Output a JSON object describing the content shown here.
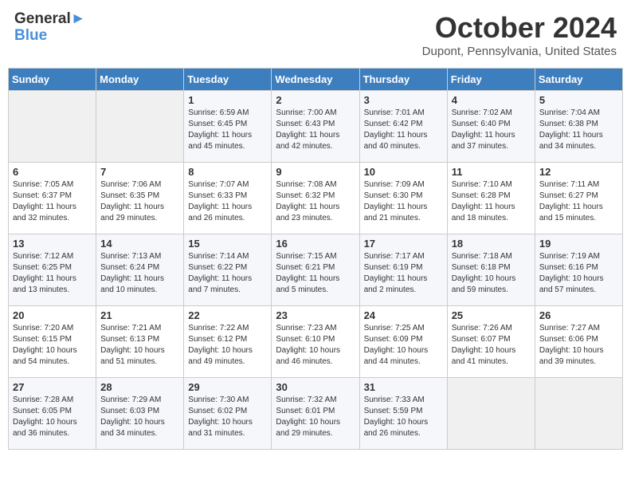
{
  "header": {
    "logo_line1": "General",
    "logo_line2": "Blue",
    "month_title": "October 2024",
    "subtitle": "Dupont, Pennsylvania, United States"
  },
  "days_of_week": [
    "Sunday",
    "Monday",
    "Tuesday",
    "Wednesday",
    "Thursday",
    "Friday",
    "Saturday"
  ],
  "weeks": [
    [
      null,
      null,
      {
        "num": "1",
        "sunrise": "Sunrise: 6:59 AM",
        "sunset": "Sunset: 6:45 PM",
        "daylight": "Daylight: 11 hours and 45 minutes."
      },
      {
        "num": "2",
        "sunrise": "Sunrise: 7:00 AM",
        "sunset": "Sunset: 6:43 PM",
        "daylight": "Daylight: 11 hours and 42 minutes."
      },
      {
        "num": "3",
        "sunrise": "Sunrise: 7:01 AM",
        "sunset": "Sunset: 6:42 PM",
        "daylight": "Daylight: 11 hours and 40 minutes."
      },
      {
        "num": "4",
        "sunrise": "Sunrise: 7:02 AM",
        "sunset": "Sunset: 6:40 PM",
        "daylight": "Daylight: 11 hours and 37 minutes."
      },
      {
        "num": "5",
        "sunrise": "Sunrise: 7:04 AM",
        "sunset": "Sunset: 6:38 PM",
        "daylight": "Daylight: 11 hours and 34 minutes."
      }
    ],
    [
      {
        "num": "6",
        "sunrise": "Sunrise: 7:05 AM",
        "sunset": "Sunset: 6:37 PM",
        "daylight": "Daylight: 11 hours and 32 minutes."
      },
      {
        "num": "7",
        "sunrise": "Sunrise: 7:06 AM",
        "sunset": "Sunset: 6:35 PM",
        "daylight": "Daylight: 11 hours and 29 minutes."
      },
      {
        "num": "8",
        "sunrise": "Sunrise: 7:07 AM",
        "sunset": "Sunset: 6:33 PM",
        "daylight": "Daylight: 11 hours and 26 minutes."
      },
      {
        "num": "9",
        "sunrise": "Sunrise: 7:08 AM",
        "sunset": "Sunset: 6:32 PM",
        "daylight": "Daylight: 11 hours and 23 minutes."
      },
      {
        "num": "10",
        "sunrise": "Sunrise: 7:09 AM",
        "sunset": "Sunset: 6:30 PM",
        "daylight": "Daylight: 11 hours and 21 minutes."
      },
      {
        "num": "11",
        "sunrise": "Sunrise: 7:10 AM",
        "sunset": "Sunset: 6:28 PM",
        "daylight": "Daylight: 11 hours and 18 minutes."
      },
      {
        "num": "12",
        "sunrise": "Sunrise: 7:11 AM",
        "sunset": "Sunset: 6:27 PM",
        "daylight": "Daylight: 11 hours and 15 minutes."
      }
    ],
    [
      {
        "num": "13",
        "sunrise": "Sunrise: 7:12 AM",
        "sunset": "Sunset: 6:25 PM",
        "daylight": "Daylight: 11 hours and 13 minutes."
      },
      {
        "num": "14",
        "sunrise": "Sunrise: 7:13 AM",
        "sunset": "Sunset: 6:24 PM",
        "daylight": "Daylight: 11 hours and 10 minutes."
      },
      {
        "num": "15",
        "sunrise": "Sunrise: 7:14 AM",
        "sunset": "Sunset: 6:22 PM",
        "daylight": "Daylight: 11 hours and 7 minutes."
      },
      {
        "num": "16",
        "sunrise": "Sunrise: 7:15 AM",
        "sunset": "Sunset: 6:21 PM",
        "daylight": "Daylight: 11 hours and 5 minutes."
      },
      {
        "num": "17",
        "sunrise": "Sunrise: 7:17 AM",
        "sunset": "Sunset: 6:19 PM",
        "daylight": "Daylight: 11 hours and 2 minutes."
      },
      {
        "num": "18",
        "sunrise": "Sunrise: 7:18 AM",
        "sunset": "Sunset: 6:18 PM",
        "daylight": "Daylight: 10 hours and 59 minutes."
      },
      {
        "num": "19",
        "sunrise": "Sunrise: 7:19 AM",
        "sunset": "Sunset: 6:16 PM",
        "daylight": "Daylight: 10 hours and 57 minutes."
      }
    ],
    [
      {
        "num": "20",
        "sunrise": "Sunrise: 7:20 AM",
        "sunset": "Sunset: 6:15 PM",
        "daylight": "Daylight: 10 hours and 54 minutes."
      },
      {
        "num": "21",
        "sunrise": "Sunrise: 7:21 AM",
        "sunset": "Sunset: 6:13 PM",
        "daylight": "Daylight: 10 hours and 51 minutes."
      },
      {
        "num": "22",
        "sunrise": "Sunrise: 7:22 AM",
        "sunset": "Sunset: 6:12 PM",
        "daylight": "Daylight: 10 hours and 49 minutes."
      },
      {
        "num": "23",
        "sunrise": "Sunrise: 7:23 AM",
        "sunset": "Sunset: 6:10 PM",
        "daylight": "Daylight: 10 hours and 46 minutes."
      },
      {
        "num": "24",
        "sunrise": "Sunrise: 7:25 AM",
        "sunset": "Sunset: 6:09 PM",
        "daylight": "Daylight: 10 hours and 44 minutes."
      },
      {
        "num": "25",
        "sunrise": "Sunrise: 7:26 AM",
        "sunset": "Sunset: 6:07 PM",
        "daylight": "Daylight: 10 hours and 41 minutes."
      },
      {
        "num": "26",
        "sunrise": "Sunrise: 7:27 AM",
        "sunset": "Sunset: 6:06 PM",
        "daylight": "Daylight: 10 hours and 39 minutes."
      }
    ],
    [
      {
        "num": "27",
        "sunrise": "Sunrise: 7:28 AM",
        "sunset": "Sunset: 6:05 PM",
        "daylight": "Daylight: 10 hours and 36 minutes."
      },
      {
        "num": "28",
        "sunrise": "Sunrise: 7:29 AM",
        "sunset": "Sunset: 6:03 PM",
        "daylight": "Daylight: 10 hours and 34 minutes."
      },
      {
        "num": "29",
        "sunrise": "Sunrise: 7:30 AM",
        "sunset": "Sunset: 6:02 PM",
        "daylight": "Daylight: 10 hours and 31 minutes."
      },
      {
        "num": "30",
        "sunrise": "Sunrise: 7:32 AM",
        "sunset": "Sunset: 6:01 PM",
        "daylight": "Daylight: 10 hours and 29 minutes."
      },
      {
        "num": "31",
        "sunrise": "Sunrise: 7:33 AM",
        "sunset": "Sunset: 5:59 PM",
        "daylight": "Daylight: 10 hours and 26 minutes."
      },
      null,
      null
    ]
  ]
}
